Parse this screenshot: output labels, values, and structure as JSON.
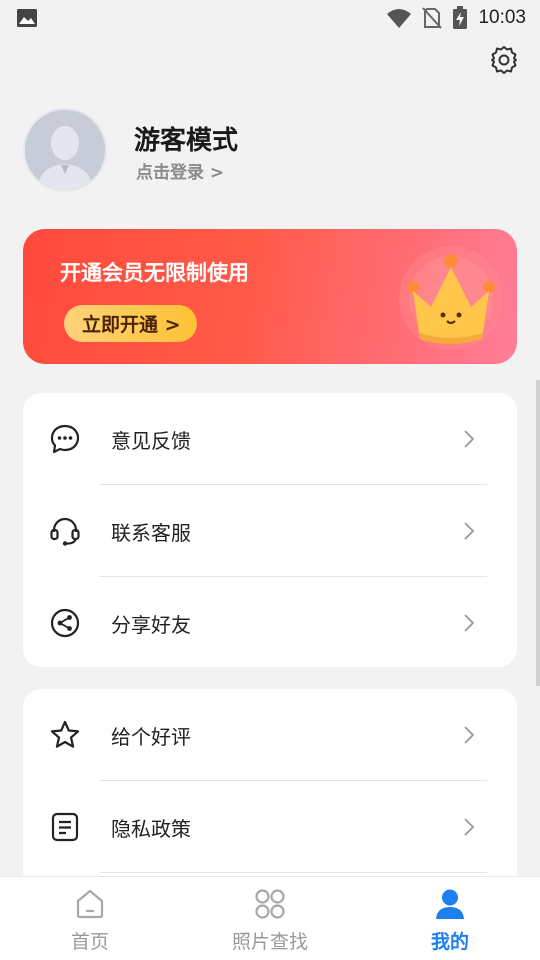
{
  "status_bar": {
    "time": "10:03",
    "icons": [
      "image-icon",
      "wifi-icon",
      "no-sim-icon",
      "battery-charging-icon"
    ]
  },
  "header": {
    "settings_icon": "gear-icon"
  },
  "profile": {
    "name": "游客模式",
    "login_text": "点击登录 >"
  },
  "vip_banner": {
    "title": "开通会员无限制使用",
    "button_label": "立即开通 >",
    "colors": {
      "start": "#ff4a3c",
      "end": "#ff7e98",
      "button": "#ffc233"
    }
  },
  "menu_group_1": [
    {
      "label": "意见反馈",
      "icon": "chat-bubble-icon"
    },
    {
      "label": "联系客服",
      "icon": "headset-icon"
    },
    {
      "label": "分享好友",
      "icon": "share-icon"
    }
  ],
  "menu_group_2": [
    {
      "label": "给个好评",
      "icon": "star-icon"
    },
    {
      "label": "隐私政策",
      "icon": "document-icon"
    }
  ],
  "bottom_nav": {
    "items": [
      {
        "label": "首页",
        "icon": "home-icon",
        "active": false
      },
      {
        "label": "照片查找",
        "icon": "grid-icon",
        "active": false
      },
      {
        "label": "我的",
        "icon": "user-icon",
        "active": true
      }
    ],
    "active_color": "#1e7ff0"
  }
}
